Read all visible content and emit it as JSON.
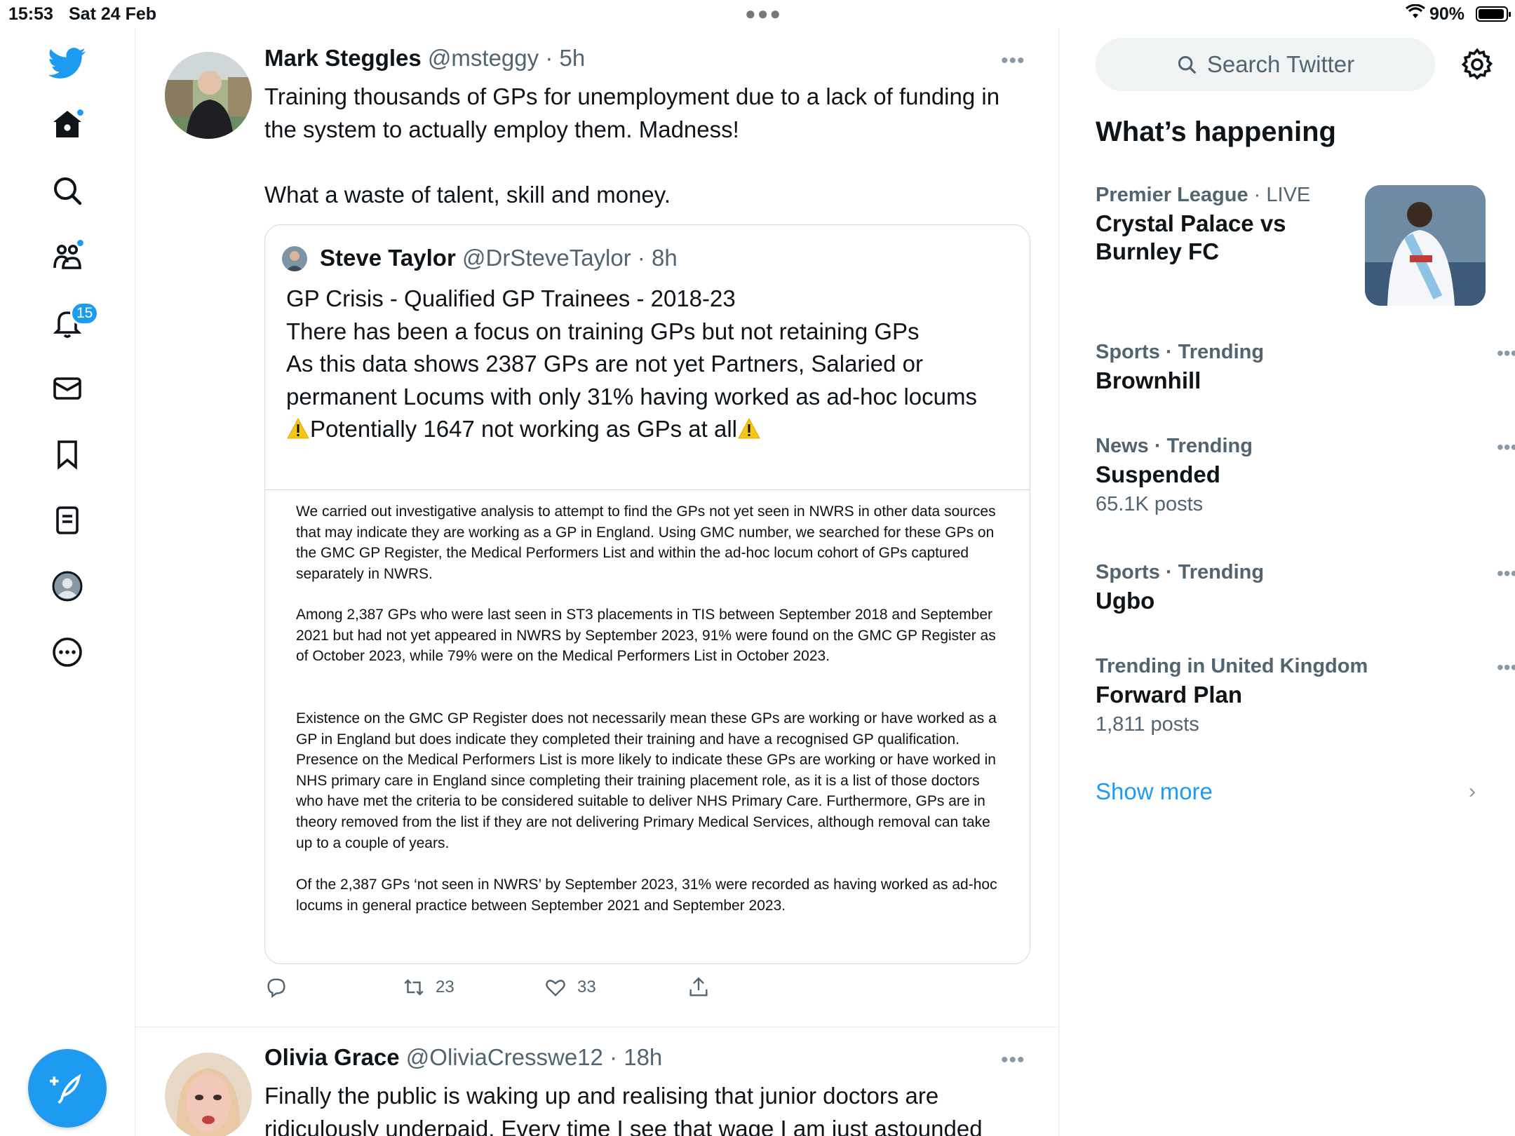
{
  "status": {
    "time": "15:53",
    "date": "Sat 24 Feb",
    "battery": "90%",
    "battery_level": 0.9
  },
  "nav": {
    "notifications_count": "15"
  },
  "tweets": [
    {
      "name": "Mark Steggles",
      "handle": "@msteggy",
      "time": "· 5h",
      "text1": "Training thousands of GPs for unemployment due to a lack of funding in the system to actually employ them. Madness!",
      "text2": "What a waste of talent, skill and money.",
      "quote": {
        "name": "Steve Taylor",
        "handle": "@DrSteveTaylor",
        "time": "· 8h",
        "lines": [
          "GP Crisis - Qualified GP Trainees - 2018-23",
          "There has been a focus on training GPs but not retaining GPs",
          "As this data shows 2387 GPs are not yet Partners, Salaried or",
          "permanent Locums with only 31% having worked as ad-hoc locums",
          "Potentially 1647 not working as GPs at all"
        ],
        "image_paragraphs": [
          "We carried out investigative analysis to attempt to find the GPs not yet seen in NWRS in other data sources that may indicate they are working as a GP in England. Using GMC number, we searched for these GPs on the GMC GP Register, the Medical Performers List and within the ad-hoc locum cohort of GPs captured separately in NWRS.",
          "Among 2,387 GPs who were last seen in ST3 placements in TIS between September 2018 and September 2021 but had not yet appeared in NWRS by September 2023, 91% were found on the GMC GP Register as of October 2023, while 79% were on the Medical Performers List in October 2023.",
          "Existence on the GMC GP Register does not necessarily mean these GPs are working or have worked as a GP in England but does indicate they completed their training and have a recognised GP qualification. Presence on the Medical Performers List is more likely to indicate these GPs are working or have worked in NHS primary care in England since completing their training placement role, as it is a list of those doctors who have met the criteria to be considered suitable to deliver NHS Primary Care. Furthermore, GPs are in theory removed from the list if they are not delivering Primary Medical Services, although removal can take up to a couple of years.",
          "Of the 2,387 GPs ‘not seen in NWRS’ by September 2023, 31% were recorded as having worked as ad-hoc locums in general practice between September 2021 and September 2023."
        ]
      },
      "retweets": "23",
      "likes": "33"
    },
    {
      "name": "Olivia Grace",
      "handle": "@OliviaCresswe12",
      "time": "· 18h",
      "text1": "Finally the public is waking up and realising that junior doctors are ridiculously underpaid. Every time I see that wage I am just astounded"
    }
  ],
  "sidebar": {
    "search_placeholder": "Search Twitter",
    "title": "What’s happening",
    "trends": [
      {
        "context": "Premier League",
        "context_extra": "· LIVE",
        "title": "Crystal Palace vs Burnley FC",
        "count": ""
      },
      {
        "context": "Sports · Trending",
        "context_extra": "",
        "title": "Brownhill",
        "count": ""
      },
      {
        "context": "News · Trending",
        "context_extra": "",
        "title": "Suspended",
        "count": "65.1K posts"
      },
      {
        "context": "Sports · Trending",
        "context_extra": "",
        "title": "Ugbo",
        "count": ""
      },
      {
        "context": "Trending in United Kingdom",
        "context_extra": "",
        "title": "Forward Plan",
        "count": "1,811 posts"
      }
    ],
    "show_more": "Show more"
  },
  "colors": {
    "accent": "#1d9bf0",
    "secondary_text": "#536471",
    "text": "#0f1419"
  }
}
